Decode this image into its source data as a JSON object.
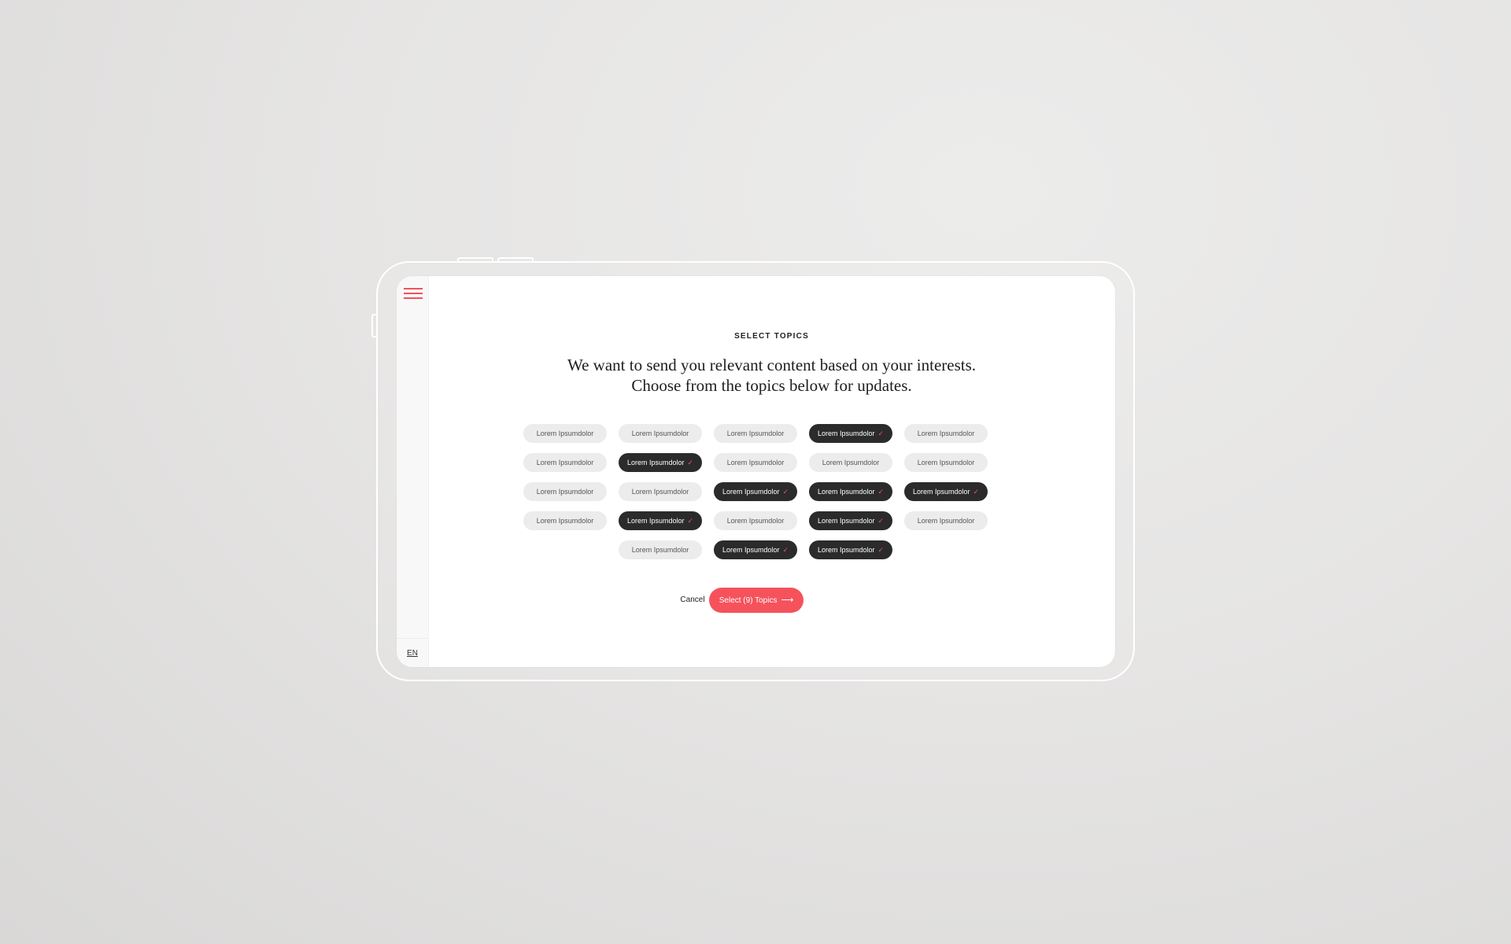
{
  "sidebar": {
    "menu_icon": "hamburger-menu-icon",
    "language": "EN"
  },
  "main": {
    "eyebrow": "SELECT TOPICS",
    "headline_line1": "We want to send you relevant content based on your interests.",
    "headline_line2": "Choose from the topics below for updates."
  },
  "topics": [
    {
      "label": "Lorem Ipsumdolor",
      "selected": false
    },
    {
      "label": "Lorem Ipsumdolor",
      "selected": false
    },
    {
      "label": "Lorem Ipsumdolor",
      "selected": false
    },
    {
      "label": "Lorem Ipsumdolor",
      "selected": true
    },
    {
      "label": "Lorem Ipsumdolor",
      "selected": false
    },
    {
      "label": "Lorem Ipsumdolor",
      "selected": false
    },
    {
      "label": "Lorem Ipsumdolor",
      "selected": true
    },
    {
      "label": "Lorem Ipsumdolor",
      "selected": false
    },
    {
      "label": "Lorem Ipsumdolor",
      "selected": false
    },
    {
      "label": "Lorem Ipsumdolor",
      "selected": false
    },
    {
      "label": "Lorem Ipsumdolor",
      "selected": false
    },
    {
      "label": "Lorem Ipsumdolor",
      "selected": false
    },
    {
      "label": "Lorem Ipsumdolor",
      "selected": true
    },
    {
      "label": "Lorem Ipsumdolor",
      "selected": true
    },
    {
      "label": "Lorem Ipsumdolor",
      "selected": true
    },
    {
      "label": "Lorem Ipsumdolor",
      "selected": false
    },
    {
      "label": "Lorem Ipsumdolor",
      "selected": true
    },
    {
      "label": "Lorem Ipsumdolor",
      "selected": false
    },
    {
      "label": "Lorem Ipsumdolor",
      "selected": true
    },
    {
      "label": "Lorem Ipsumdolor",
      "selected": false
    },
    {
      "label": "Lorem Ipsumdolor",
      "selected": false
    },
    {
      "label": "Lorem Ipsumdolor",
      "selected": true
    },
    {
      "label": "Lorem Ipsumdolor",
      "selected": true
    }
  ],
  "actions": {
    "cancel_label": "Cancel",
    "submit_label": "Select (9) Topics",
    "submit_icon": "arrow-right-icon"
  },
  "colors": {
    "accent": "#f5525c",
    "chip_selected_bg": "#2b2b2b",
    "chip_default_bg": "#ececec"
  }
}
